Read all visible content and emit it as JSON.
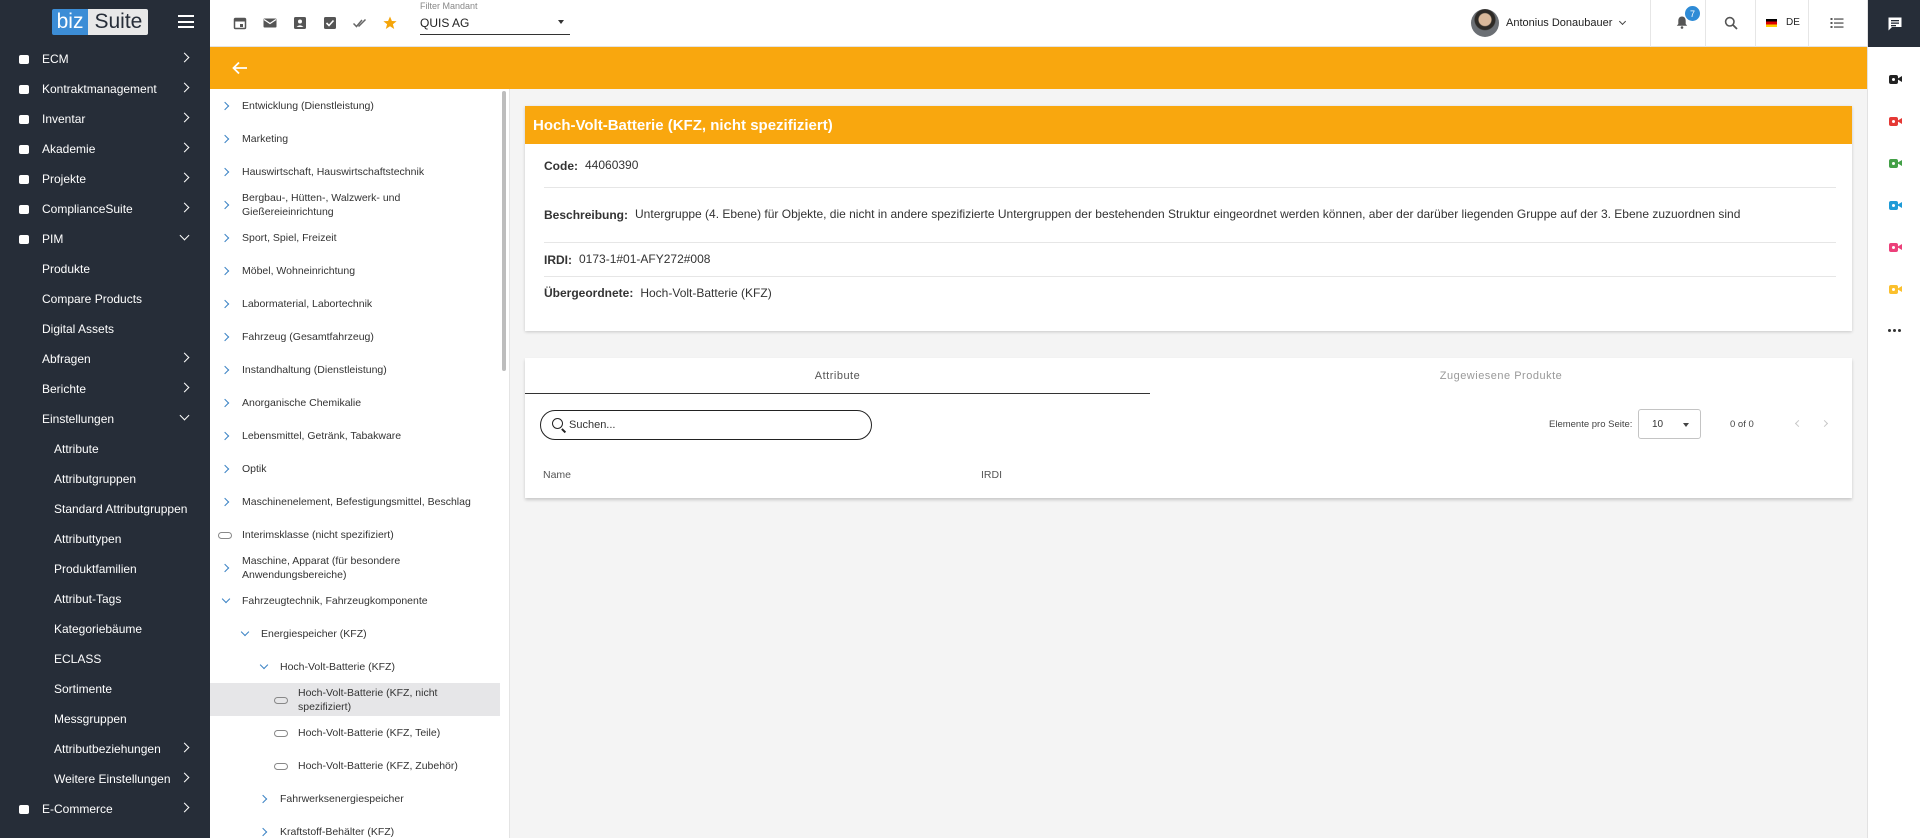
{
  "sidebar": {
    "logo_part1": "biz",
    "logo_part2": "Suite",
    "items": [
      {
        "label": "ECM"
      },
      {
        "label": "Kontraktmanagement"
      },
      {
        "label": "Inventar"
      },
      {
        "label": "Akademie"
      },
      {
        "label": "Projekte"
      },
      {
        "label": "ComplianceSuite"
      },
      {
        "label": "PIM"
      },
      {
        "label": "Produkte"
      },
      {
        "label": "Compare Products"
      },
      {
        "label": "Digital Assets"
      },
      {
        "label": "Abfragen"
      },
      {
        "label": "Berichte"
      },
      {
        "label": "Einstellungen"
      },
      {
        "label": "Attribute"
      },
      {
        "label": "Attributgruppen"
      },
      {
        "label": "Standard Attributgruppen"
      },
      {
        "label": "Attributtypen"
      },
      {
        "label": "Produktfamilien"
      },
      {
        "label": "Attribut-Tags"
      },
      {
        "label": "Kategoriebäume"
      },
      {
        "label": "ECLASS"
      },
      {
        "label": "Sortimente"
      },
      {
        "label": "Messgruppen"
      },
      {
        "label": "Attributbeziehungen"
      },
      {
        "label": "Weitere Einstellungen"
      },
      {
        "label": "E-Commerce"
      }
    ]
  },
  "topbar": {
    "filter_label": "Filter Mandant",
    "filter_value": "QUIS AG",
    "user_name": "Antonius Donaubauer",
    "notification_count": "7",
    "language": "DE",
    "icons": [
      "calendar-icon",
      "mail-icon",
      "contact-icon",
      "checkbox-icon",
      "double-check-icon",
      "star-icon",
      "bell-icon",
      "search-icon",
      "list-icon"
    ]
  },
  "tree": {
    "items": [
      {
        "label": "Entwicklung (Dienstleistung)"
      },
      {
        "label": "Marketing"
      },
      {
        "label": "Hauswirtschaft, Hauswirtschaftstechnik"
      },
      {
        "label": "Bergbau-, Hütten-, Walzwerk- und Gießereieinrichtung"
      },
      {
        "label": "Sport, Spiel, Freizeit"
      },
      {
        "label": "Möbel, Wohneinrichtung"
      },
      {
        "label": "Labormaterial, Labortechnik"
      },
      {
        "label": "Fahrzeug (Gesamtfahrzeug)"
      },
      {
        "label": "Instandhaltung (Dienstleistung)"
      },
      {
        "label": "Anorganische Chemikalie"
      },
      {
        "label": "Lebensmittel, Getränk, Tabakware"
      },
      {
        "label": "Optik"
      },
      {
        "label": "Maschinenelement, Befestigungsmittel, Beschlag"
      },
      {
        "label": "Interimsklasse (nicht spezifiziert)"
      },
      {
        "label": "Maschine, Apparat (für besondere Anwendungsbereiche)"
      },
      {
        "label": "Fahrzeugtechnik, Fahrzeugkomponente"
      },
      {
        "label": "Energiespeicher (KFZ)"
      },
      {
        "label": "Hoch-Volt-Batterie (KFZ)"
      },
      {
        "label": "Hoch-Volt-Batterie (KFZ, nicht spezifiziert)"
      },
      {
        "label": "Hoch-Volt-Batterie (KFZ, Teile)"
      },
      {
        "label": "Hoch-Volt-Batterie (KFZ, Zubehör)"
      },
      {
        "label": "Fahrwerksenergiespeicher"
      },
      {
        "label": "Kraftstoff-Behälter (KFZ)"
      }
    ]
  },
  "detail": {
    "title": "Hoch-Volt-Batterie (KFZ, nicht spezifiziert)",
    "code_label": "Code:",
    "code_value": "44060390",
    "desc_label": "Beschreibung:",
    "desc_value": "Untergruppe (4. Ebene) für Objekte, die nicht in andere spezifizierte Untergruppen der bestehenden Struktur eingeordnet werden können, aber der darüber liegenden Gruppe auf der 3. Ebene zuzuordnen sind",
    "irdi_label": "IRDI:",
    "irdi_value": "0173-1#01-AFY272#008",
    "parent_label": "Übergeordnete:",
    "parent_value": "Hoch-Volt-Batterie (KFZ)"
  },
  "tabs": {
    "attributes": "Attribute",
    "products": "Zugewiesene Produkte",
    "search_placeholder": "Suchen...",
    "per_page_label": "Elemente pro Seite:",
    "per_page_value": "10",
    "page_count": "0 of 0",
    "col_name": "Name",
    "col_irdi": "IRDI"
  },
  "rail": {
    "cam_colors": [
      "#222222",
      "#e53935",
      "#43a047",
      "#1e9bd7",
      "#ec407a",
      "#fbc02d"
    ]
  }
}
